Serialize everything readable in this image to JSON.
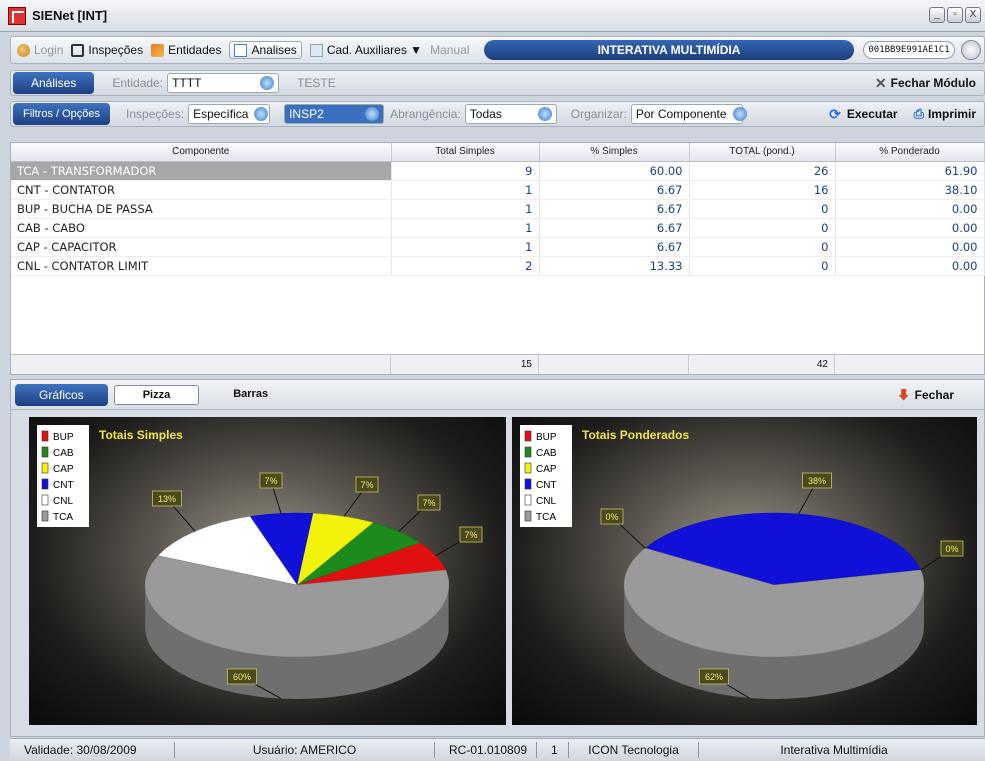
{
  "window": {
    "title": "SIENet [INT]",
    "buttons": [
      "_",
      "▫",
      "X"
    ]
  },
  "toolbar": {
    "items": [
      {
        "label": "Login",
        "icon": "login-icon"
      },
      {
        "label": "Inspeções",
        "icon": "inspections-icon"
      },
      {
        "label": "Entidades",
        "icon": "entities-icon"
      },
      {
        "label": "Analises",
        "icon": "analysis-icon"
      },
      {
        "label": "Cad. Auxiliares ▼",
        "icon": "aux-register-icon"
      },
      {
        "label": "Manual",
        "icon": ""
      }
    ],
    "banner": "INTERATIVA MULTIMÍDIA",
    "serial": "001BB9E991AE1C1"
  },
  "analises_bar": {
    "tab": "Análises",
    "entidade_label": "Entidade:",
    "entidade_value": "TTTT",
    "entidade_name": "TESTE",
    "close_module": "Fechar Módulo"
  },
  "filters_bar": {
    "tab": "Filtros / Opções",
    "inspecoes_label": "Inspeções:",
    "inspecoes_value": "Específica",
    "insp_value": "INSP2",
    "abrangencia_label": "Abrangência:",
    "abrangencia_value": "Todas",
    "organizar_label": "Organizar:",
    "organizar_value": "Por Componente",
    "execute": "Executar",
    "print": "Imprimir"
  },
  "grid": {
    "columns": [
      "Componente",
      "Total Simples",
      "% Simples",
      "TOTAL (pond.)",
      "% Ponderado"
    ],
    "rows": [
      [
        "TCA - TRANSFORMADOR",
        "9",
        "60.00",
        "26",
        "61.90"
      ],
      [
        "CNT - CONTATOR",
        "1",
        "6.67",
        "16",
        "38.10"
      ],
      [
        "BUP - BUCHA DE PASSA",
        "1",
        "6.67",
        "0",
        "0.00"
      ],
      [
        "CAB - CABO",
        "1",
        "6.67",
        "0",
        "0.00"
      ],
      [
        "CAP - CAPACITOR",
        "1",
        "6.67",
        "0",
        "0.00"
      ],
      [
        "CNL - CONTATOR LIMIT",
        "2",
        "13.33",
        "0",
        "0.00"
      ]
    ],
    "totals": {
      "simples": "15",
      "ponderado": "42"
    }
  },
  "charts_panel": {
    "tab": "Gráficos",
    "tabs": [
      "Pizza",
      "Barras"
    ],
    "close": "Fechar"
  },
  "legend": [
    "BUP",
    "CAB",
    "CAP",
    "CNT",
    "CNL",
    "TCA"
  ],
  "colors": {
    "BUP": "#e01010",
    "CAB": "#1c8a1c",
    "CAP": "#f2f20a",
    "CNT": "#1010d8",
    "CNL": "#ffffff",
    "TCA": "#9a9a9a"
  },
  "chart_data": [
    {
      "type": "pie",
      "title": "Totais Simples",
      "categories": [
        "BUP",
        "CAB",
        "CAP",
        "CNT",
        "CNL",
        "TCA"
      ],
      "values": [
        6.67,
        6.67,
        6.67,
        6.67,
        13.33,
        60.0
      ],
      "labels": [
        "7%",
        "7%",
        "7%",
        "7%",
        "13%",
        "60%"
      ]
    },
    {
      "type": "pie",
      "title": "Totais Ponderados",
      "categories": [
        "BUP",
        "CAB",
        "CAP",
        "CNT",
        "CNL",
        "TCA"
      ],
      "values": [
        0,
        0,
        0,
        38.1,
        0,
        61.9
      ],
      "labels": [
        "0%",
        "",
        "",
        "38%",
        "0%",
        "62%"
      ]
    }
  ],
  "status": {
    "validade": "Validade: 30/08/2009",
    "usuario": "Usuário: AMERICO",
    "code": "RC-01.010809",
    "page": "1",
    "company": "ICON Tecnologia",
    "product": "Interativa Multimídia"
  }
}
